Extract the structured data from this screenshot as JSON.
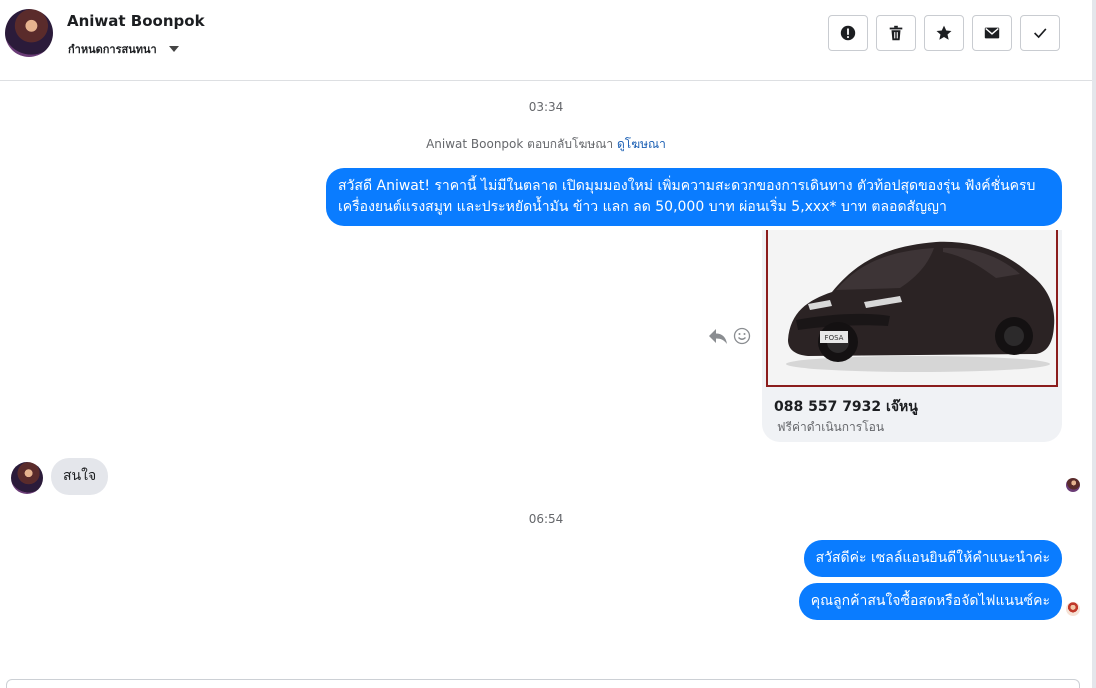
{
  "header": {
    "name": "Aniwat Boonpok",
    "subtitle": "กำหนดการสนทนา",
    "actions": [
      {
        "name": "report",
        "icon": "alert-icon"
      },
      {
        "name": "delete",
        "icon": "trash-icon"
      },
      {
        "name": "star",
        "icon": "star-icon"
      },
      {
        "name": "mark-unread",
        "icon": "envelope-icon"
      },
      {
        "name": "done",
        "icon": "check-icon"
      }
    ]
  },
  "conversation": {
    "time_1": "03:34",
    "ad_note_prefix": "Aniwat Boonpok ตอบกลับโฆษณา",
    "ad_note_link": "ดูโฆษณา",
    "ad_message": "สวัสดี Aniwat! ราคานี้ ไม่มีในตลาด เปิดมุมมองใหม่ เพิ่มความสะดวกของการเดินทาง ตัวท้อปสุดของรุ่น ฟังค์ชั่นครบ เครื่องยนต์แรงสมูท และประหยัดน้ำมัน ข้าว แลก ลด 50,000 บาท ผ่อนเริ่ม 5,xxx* บาท ตลอดสัญญา",
    "card": {
      "title": "088 557 7932 เจ๊หนู",
      "subtitle": "ฟรีค่าดำเนินการโอน",
      "plate_text": "FOSA"
    },
    "incoming_message": "สนใจ",
    "time_2": "06:54",
    "reply_1": "สวัสดีค่ะ เซลล์แอนยินดีให้คำแนะนำค่ะ",
    "reply_2": "คุณลูกค้าสนใจซื้อสดหรือจัดไฟแนนซ์คะ"
  },
  "colors": {
    "outgoing_bubble": "#0a7cff",
    "incoming_bubble": "#e4e6eb",
    "link": "#1a5fb4"
  }
}
